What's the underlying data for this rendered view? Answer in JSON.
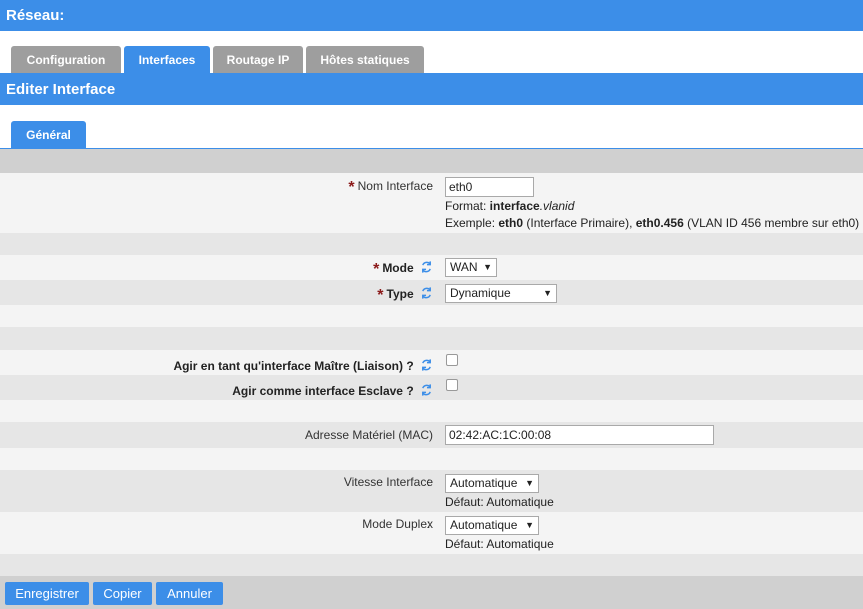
{
  "header": {
    "title": "Réseau:"
  },
  "tabs": [
    {
      "label": "Configuration",
      "active": false
    },
    {
      "label": "Interfaces",
      "active": true
    },
    {
      "label": "Routage IP",
      "active": false
    },
    {
      "label": "Hôtes statiques",
      "active": false
    }
  ],
  "section": {
    "title": "Editer Interface"
  },
  "subtab": {
    "label": "Général"
  },
  "form": {
    "nom_interface": {
      "label": "Nom Interface",
      "colon": ":",
      "value": "eth0",
      "format_prefix": "Format: ",
      "format_bold": "interface",
      "format_italic": ".vlanid",
      "example_prefix": "Exemple: ",
      "example_bold1": "eth0",
      "example_mid": " (Interface Primaire), ",
      "example_bold2": "eth0.456",
      "example_suffix": " (VLAN ID 456 membre sur eth0)"
    },
    "mode": {
      "label": "Mode",
      "value": "WAN"
    },
    "type": {
      "label": "Type",
      "value": "Dynamique"
    },
    "maitre": {
      "label": "Agir en tant qu'interface Maître (Liaison) ?",
      "checked": false
    },
    "esclave": {
      "label": "Agir comme interface Esclave ?",
      "checked": false
    },
    "mac": {
      "label": "Adresse Matériel (MAC)",
      "value": "02:42:AC:1C:00:08"
    },
    "vitesse": {
      "label": "Vitesse Interface",
      "colon": ":",
      "value": "Automatique",
      "default": "Défaut: Automatique"
    },
    "duplex": {
      "label": "Mode Duplex",
      "colon": ":",
      "value": "Automatique",
      "default": "Défaut: Automatique"
    }
  },
  "buttons": {
    "save": "Enregistrer",
    "copy": "Copier",
    "cancel": "Annuler"
  },
  "colors": {
    "accent": "#3c8ee8",
    "tab_inactive": "#9e9e9e",
    "required": "#8b1a1a"
  },
  "icons": {
    "sync": "refresh-sync-icon",
    "dropdown": "chevron-down-icon"
  }
}
